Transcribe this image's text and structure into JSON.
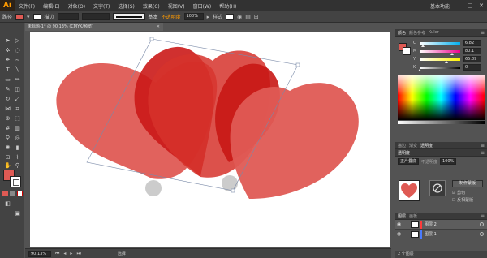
{
  "app": {
    "logo": "Ai",
    "menus": [
      "文件(F)",
      "编辑(E)",
      "对象(O)",
      "文字(T)",
      "选择(S)",
      "效果(C)",
      "视图(V)",
      "窗口(W)",
      "帮助(H)"
    ],
    "workspace": "基本功能",
    "window_buttons": [
      "–",
      "□",
      "✕"
    ]
  },
  "control_bar": {
    "mode_label": "路径",
    "stroke_weight_label": "描边",
    "brush_label": "基本",
    "warning_label": "不透明度",
    "opacity_value": "100%",
    "style_label": "样式"
  },
  "document": {
    "tab_title": "未标题-1* @ 90.13% (CMYK/预览)",
    "close": "✕",
    "zoom": "90.13%",
    "status_text": "选择"
  },
  "colors": {
    "fill": "#df5a54",
    "heart_dark": "#cb1a18",
    "heart_light": "#df5a54",
    "accent": "#ff9a00"
  },
  "color_panel": {
    "tabs": [
      "颜色",
      "颜色参考",
      "Kuler"
    ],
    "sliders": [
      {
        "label": "C",
        "value": "6.82",
        "pct": 0.07,
        "gradient": "linear-gradient(to right,#fff,#00aeef)"
      },
      {
        "label": "M",
        "value": "80.1",
        "pct": 0.8,
        "gradient": "linear-gradient(to right,#fff,#ec008c)"
      },
      {
        "label": "Y",
        "value": "65.09",
        "pct": 0.65,
        "gradient": "linear-gradient(to right,#fff,#fff200)"
      },
      {
        "label": "K",
        "value": "0",
        "pct": 0.0,
        "gradient": "linear-gradient(to right,#fff,#000)"
      }
    ]
  },
  "mid_panel": {
    "tabs": [
      "描边",
      "渐变",
      "透明度"
    ]
  },
  "transparency_panel": {
    "tabs": [
      "透明度"
    ],
    "blend_mode": "正片叠底",
    "opacity_label": "不透明度",
    "opacity_value": "100%",
    "make_mask": "制作蒙版",
    "clip": "剪切",
    "invert": "反相蒙版"
  },
  "layers_panel": {
    "tabs": [
      "图层",
      "画板"
    ],
    "layers": [
      {
        "name": "图层 2",
        "color": "#ff3b3b",
        "selected": true
      },
      {
        "name": "图层 1",
        "color": "#4a7bff",
        "selected": false
      }
    ],
    "footer": "2 个图层"
  }
}
